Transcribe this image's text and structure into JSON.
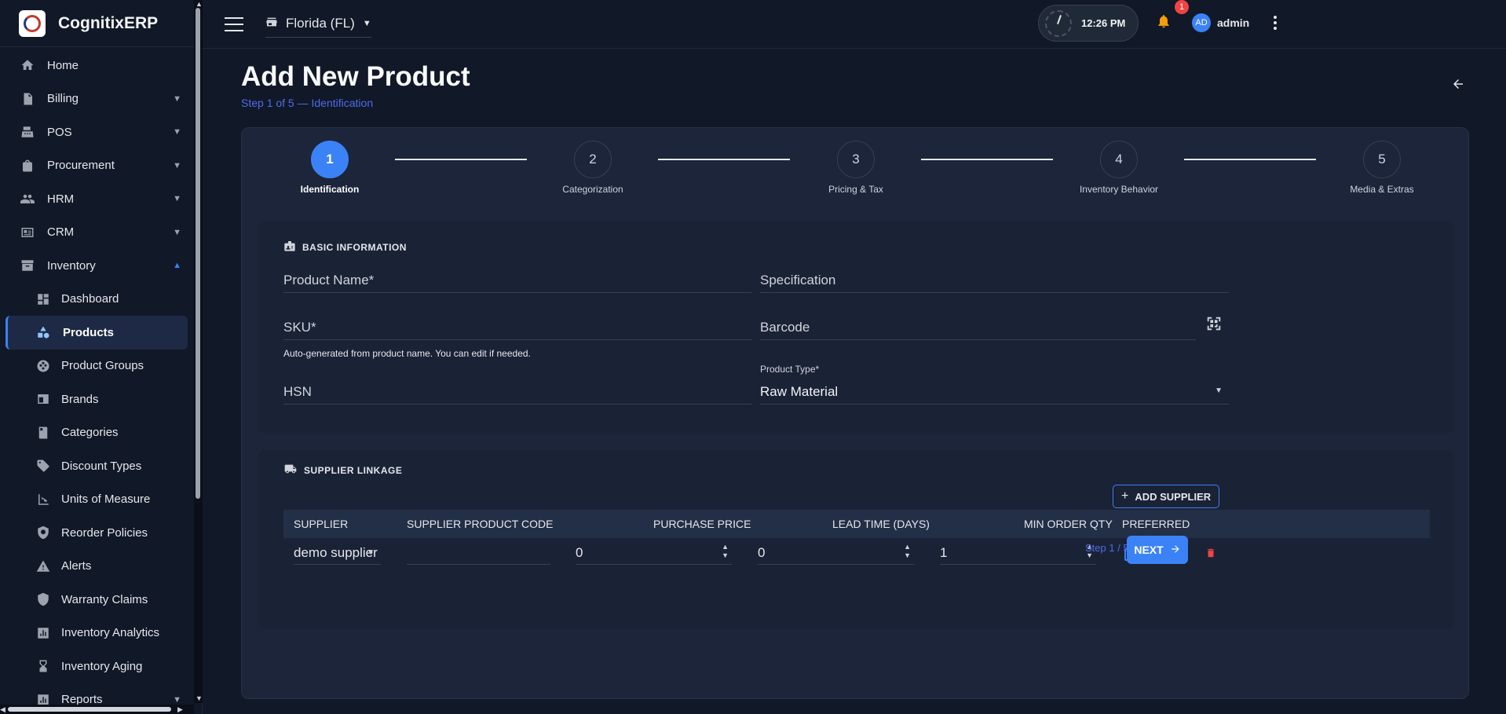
{
  "brand": {
    "name": "CognitixERP"
  },
  "sidebar": {
    "items": [
      {
        "label": "Home",
        "icon": "home-icon"
      },
      {
        "label": "Billing",
        "icon": "billing-icon"
      },
      {
        "label": "POS",
        "icon": "pos-icon"
      },
      {
        "label": "Procurement",
        "icon": "procurement-icon"
      },
      {
        "label": "HRM",
        "icon": "hrm-icon"
      },
      {
        "label": "CRM",
        "icon": "crm-icon"
      },
      {
        "label": "Inventory",
        "icon": "inventory-icon"
      }
    ],
    "sub_items": [
      {
        "label": "Dashboard",
        "icon": "dashboard-icon"
      },
      {
        "label": "Products",
        "icon": "products-icon"
      },
      {
        "label": "Product Groups",
        "icon": "product-groups-icon"
      },
      {
        "label": "Brands",
        "icon": "brands-icon"
      },
      {
        "label": "Categories",
        "icon": "categories-icon"
      },
      {
        "label": "Discount Types",
        "icon": "discount-icon"
      },
      {
        "label": "Units of Measure",
        "icon": "ruler-icon"
      },
      {
        "label": "Reorder Policies",
        "icon": "reorder-icon"
      },
      {
        "label": "Alerts",
        "icon": "alert-icon"
      },
      {
        "label": "Warranty Claims",
        "icon": "shield-icon"
      },
      {
        "label": "Inventory Analytics",
        "icon": "analytics-icon"
      },
      {
        "label": "Inventory Aging",
        "icon": "hourglass-icon"
      }
    ],
    "reports": {
      "label": "Reports",
      "icon": "reports-icon"
    }
  },
  "topbar": {
    "store": "Florida (FL)",
    "time": "12:26 PM",
    "notification_count": "1",
    "avatar_initials": "AD",
    "user": "admin"
  },
  "page": {
    "title": "Add New Product",
    "subtitle": "Step 1 of 5 — Identification"
  },
  "stepper": [
    {
      "num": "1",
      "label": "Identification"
    },
    {
      "num": "2",
      "label": "Categorization"
    },
    {
      "num": "3",
      "label": "Pricing & Tax"
    },
    {
      "num": "4",
      "label": "Inventory Behavior"
    },
    {
      "num": "5",
      "label": "Media & Extras"
    }
  ],
  "basic": {
    "heading": "BASIC INFORMATION",
    "product_name": "Product Name*",
    "specification": "Specification",
    "sku": "SKU*",
    "sku_helper": "Auto-generated from product name. You can edit if needed.",
    "barcode": "Barcode",
    "hsn": "HSN",
    "product_type_label": "Product Type*",
    "product_type_value": "Raw Material"
  },
  "supplier": {
    "heading": "SUPPLIER LINKAGE",
    "add_button": "ADD SUPPLIER",
    "columns": [
      "SUPPLIER",
      "SUPPLIER PRODUCT CODE",
      "PURCHASE PRICE",
      "LEAD TIME (DAYS)",
      "MIN ORDER QTY",
      "PREFERRED"
    ],
    "row": {
      "supplier": "demo supplier",
      "product_code": "",
      "purchase_price": "0",
      "lead_time": "0",
      "min_qty": "1"
    }
  },
  "footer": {
    "step_count": "Step 1 / 5",
    "next": "NEXT"
  },
  "colors": {
    "accent": "#3b82f6",
    "background": "#111827",
    "card": "#1c2539",
    "danger": "#ef4444",
    "warning": "#f59e0b"
  }
}
